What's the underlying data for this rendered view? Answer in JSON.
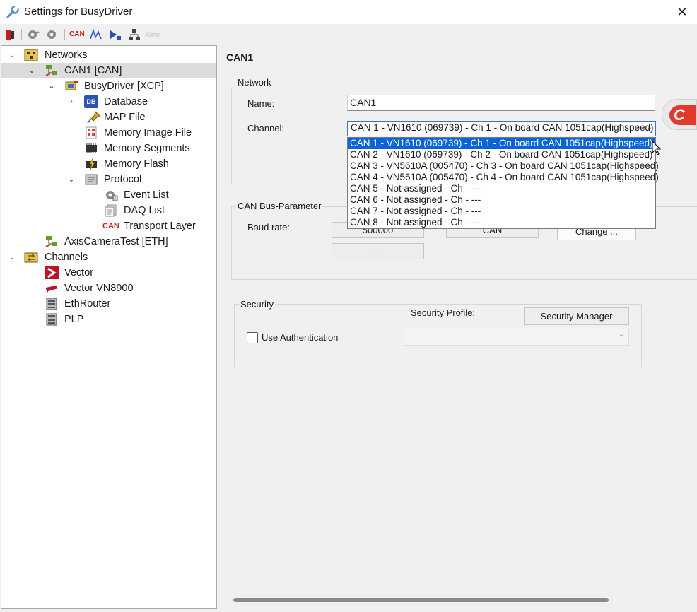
{
  "window": {
    "title": "Settings for BusyDriver",
    "close_glyph": "✕"
  },
  "toolbar": {
    "icons": [
      "exit-icon",
      "gear-add-icon",
      "gear-remove-icon",
      "can-icon",
      "signal-icon",
      "database-arrow-icon",
      "network-icon",
      "xline-icon"
    ],
    "can_text": "CAN",
    "xline_text": "Xline"
  },
  "tree": {
    "items": [
      {
        "label": "Networks",
        "level": 0,
        "expanded": true,
        "icon": "networks-icon"
      },
      {
        "label": "CAN1 [CAN]",
        "level": 1,
        "expanded": true,
        "icon": "can-network-icon",
        "selected": true
      },
      {
        "label": "BusyDriver [XCP]",
        "level": 2,
        "expanded": true,
        "icon": "ecu-icon"
      },
      {
        "label": "Database",
        "level": 3,
        "expanded": false,
        "icon": "database-icon"
      },
      {
        "label": "MAP File",
        "level": 3,
        "icon": "pin-icon"
      },
      {
        "label": "Memory Image File",
        "level": 3,
        "icon": "memory-image-icon"
      },
      {
        "label": "Memory Segments",
        "level": 3,
        "icon": "memory-segments-icon"
      },
      {
        "label": "Memory Flash",
        "level": 3,
        "icon": "memory-flash-icon"
      },
      {
        "label": "Protocol",
        "level": 3,
        "expanded": true,
        "icon": "protocol-icon"
      },
      {
        "label": "Event List",
        "level": 4,
        "icon": "event-list-icon"
      },
      {
        "label": "DAQ List",
        "level": 4,
        "icon": "daq-list-icon"
      },
      {
        "label": "Transport Layer",
        "level": 4,
        "icon": "can-transport-icon"
      },
      {
        "label": "AxisCameraTest [ETH]",
        "level": 1,
        "icon": "eth-network-icon"
      },
      {
        "label": "Channels",
        "level": 0,
        "expanded": true,
        "icon": "channels-icon"
      },
      {
        "label": "Vector",
        "level": 1,
        "icon": "vector-icon"
      },
      {
        "label": "Vector VN8900",
        "level": 1,
        "icon": "vn8900-icon"
      },
      {
        "label": "EthRouter",
        "level": 1,
        "icon": "server-icon"
      },
      {
        "label": "PLP",
        "level": 1,
        "icon": "server-icon"
      }
    ],
    "db_badge": "DB",
    "can_badge": "CAN"
  },
  "main": {
    "section_title": "CAN1",
    "network_group": {
      "label": "Network",
      "name_label": "Name:",
      "name_value": "CAN1",
      "channel_label": "Channel:",
      "channel_value": "CAN 1 - VN1610 (069739) - Ch 1 - On board CAN 1051cap(Highspeed)",
      "channel_options": [
        "CAN 1 - VN1610 (069739) - Ch 1 - On board CAN 1051cap(Highspeed)",
        "CAN 2 - VN1610 (069739) - Ch 2 - On board CAN 1051cap(Highspeed)",
        "CAN 3 - VN5610A (005470) - Ch 3 - On board CAN 1051cap(Highspeed)",
        "CAN 4 - VN5610A (005470) - Ch 4 - On board CAN 1051cap(Highspeed)",
        "CAN 5 - Not assigned - Ch  - ---",
        "CAN 6 - Not assigned - Ch  - ---",
        "CAN 7 - Not assigned - Ch  - ---",
        "CAN 8 - Not assigned - Ch  - ---"
      ],
      "selected_option_index": 0,
      "logo_text": "C"
    },
    "bus_group": {
      "label": "CAN Bus-Parameter",
      "baud_label": "Baud rate:",
      "baud_value": "500000",
      "mode_value": "CAN",
      "change_button": "Change ...",
      "second_value": "---"
    },
    "security_group": {
      "label": "Security",
      "profile_label": "Security Profile:",
      "manager_button": "Security Manager",
      "auth_label": "Use Authentication",
      "auth_checked": false
    }
  }
}
